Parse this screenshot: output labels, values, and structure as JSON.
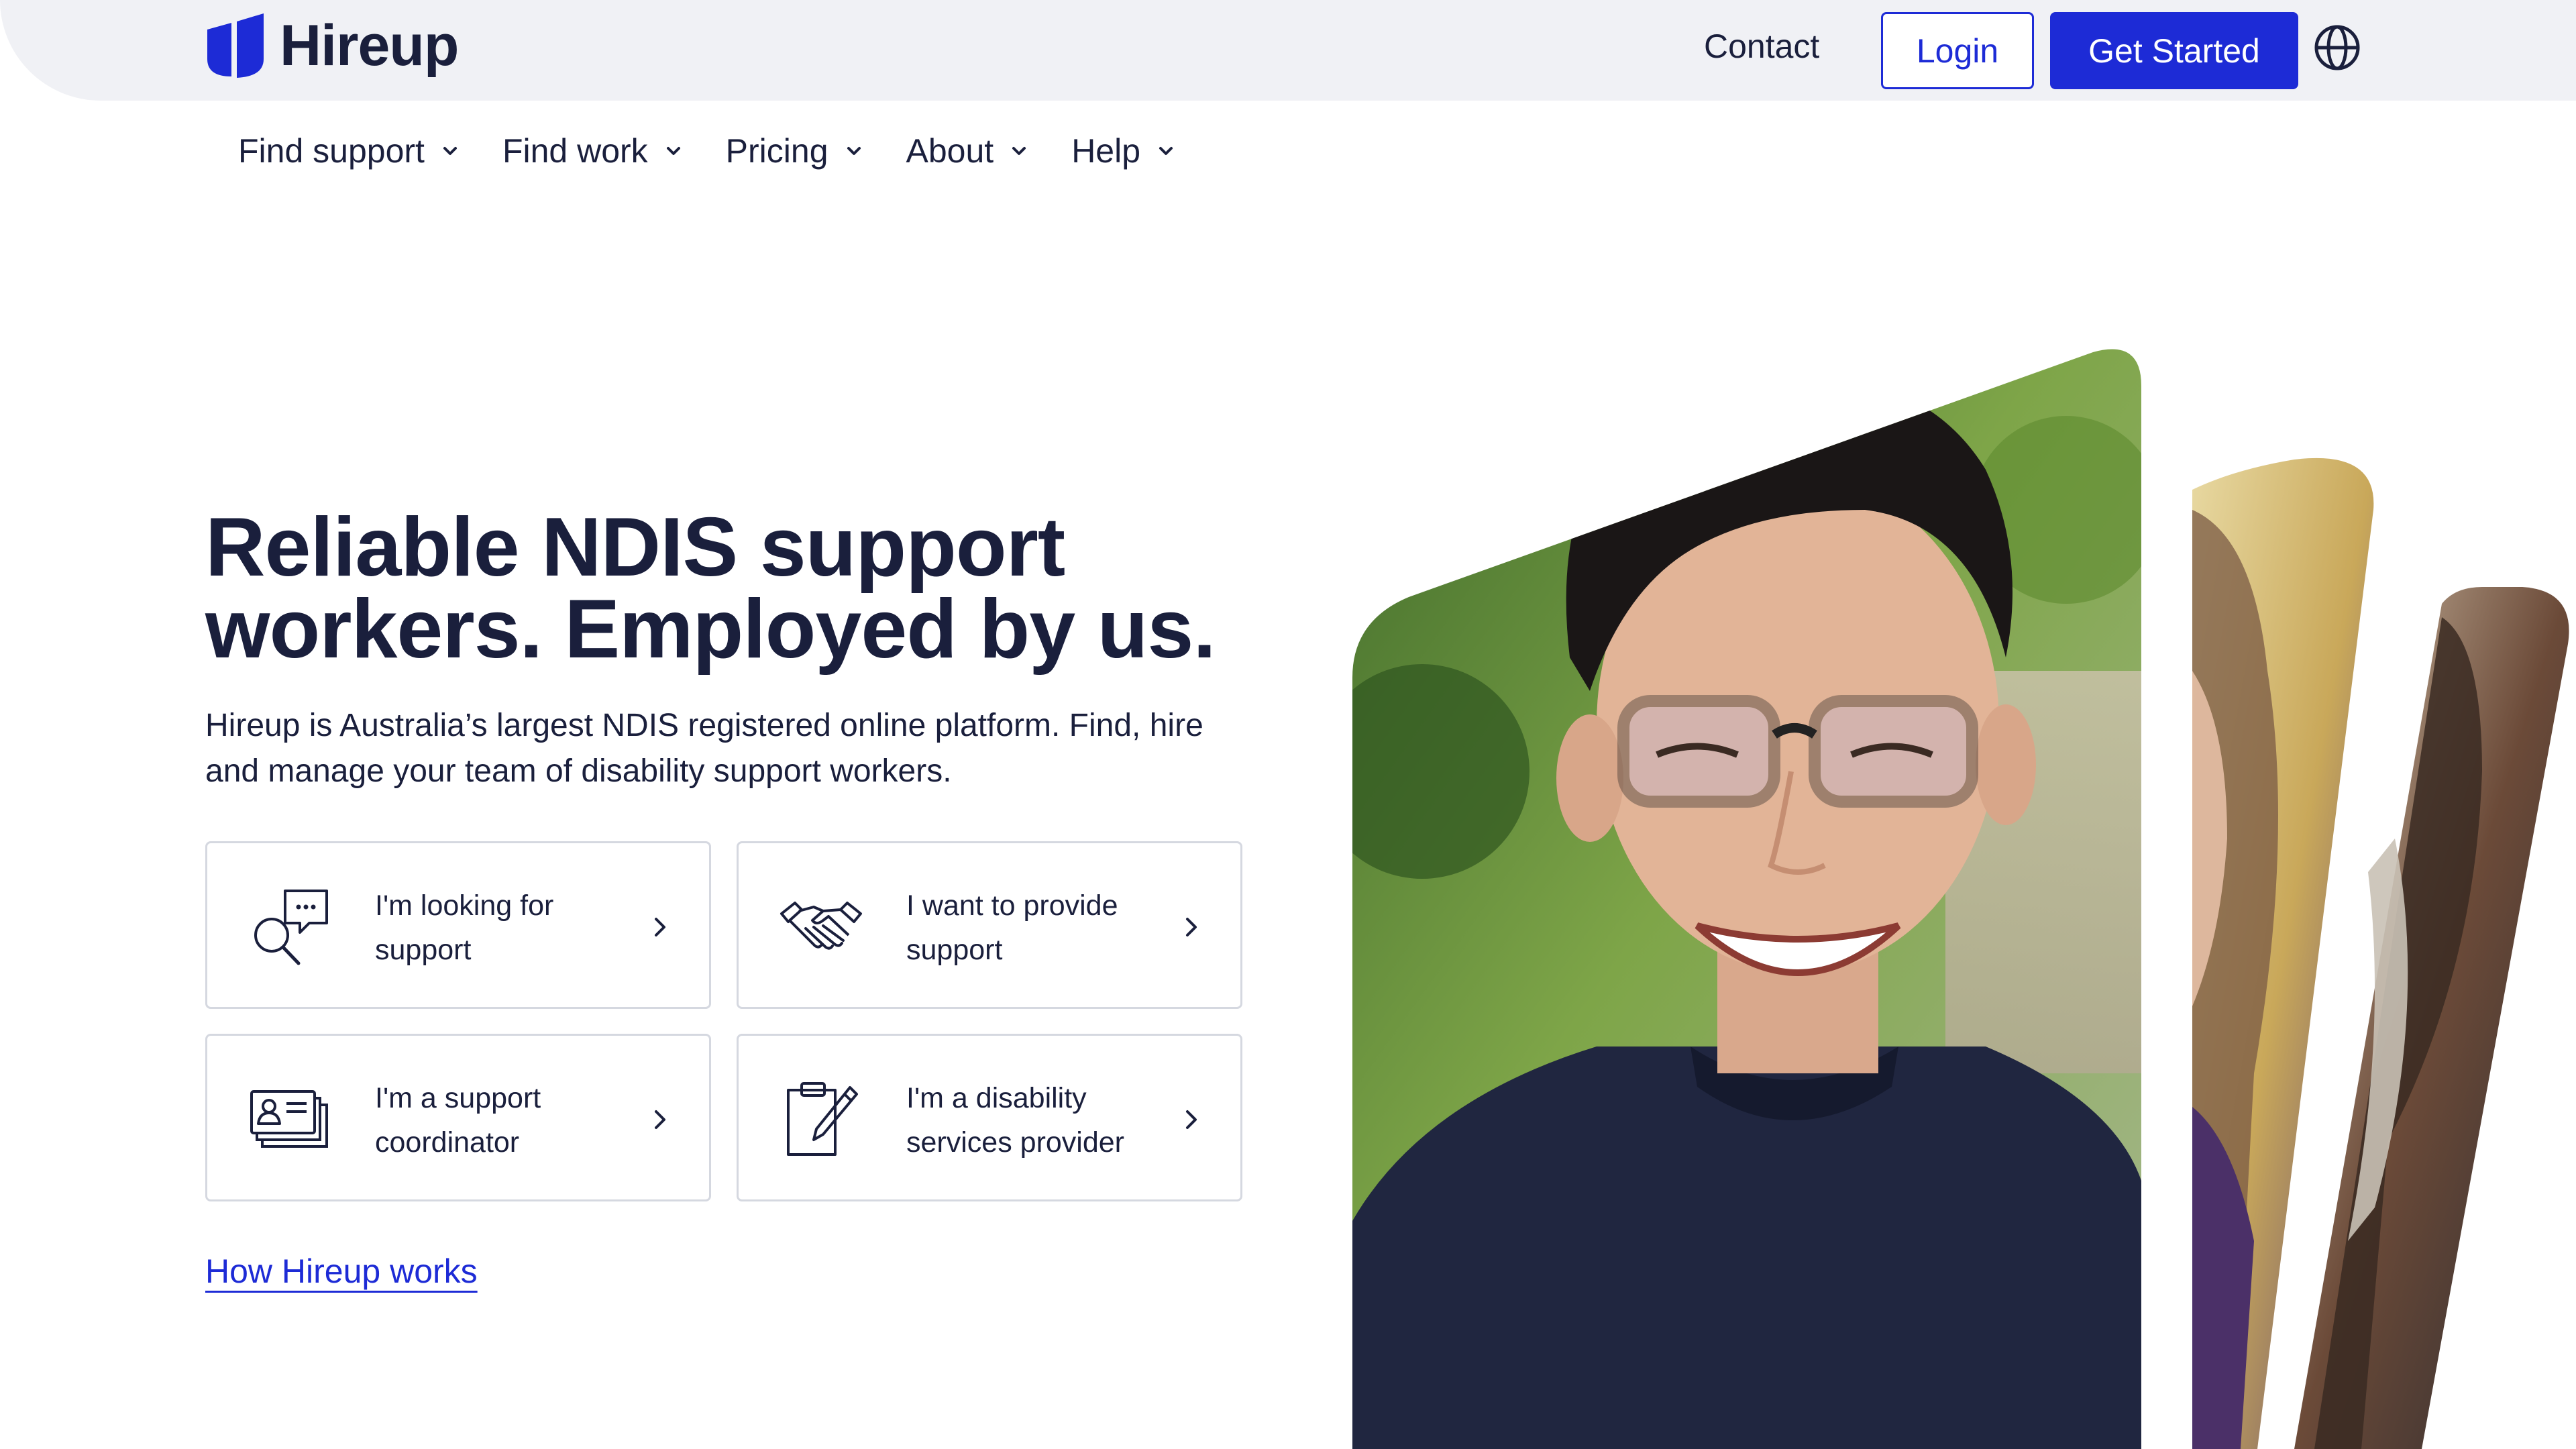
{
  "header": {
    "brand": "Hireup",
    "contact_label": "Contact",
    "login_label": "Login",
    "get_started_label": "Get Started",
    "globe_icon": "globe-icon",
    "brand_color": "#1d2bd6"
  },
  "nav": {
    "items": [
      {
        "label": "Find support"
      },
      {
        "label": "Find work"
      },
      {
        "label": "Pricing"
      },
      {
        "label": "About"
      },
      {
        "label": "Help"
      }
    ]
  },
  "hero": {
    "title_line1": "Reliable NDIS support",
    "title_line2": "workers. Employed by us.",
    "subtitle": "Hireup is Australia’s largest NDIS registered online platform. Find, hire and manage your team of disability support workers.",
    "cards": [
      {
        "label": "I'm looking for support",
        "icon": "search-chat-icon"
      },
      {
        "label": "I want to provide support",
        "icon": "handshake-icon"
      },
      {
        "label": "I'm a support coordinator",
        "icon": "id-cards-icon"
      },
      {
        "label": "I'm a disability services provider",
        "icon": "clipboard-pen-icon"
      }
    ],
    "how_link": "How Hireup works"
  }
}
